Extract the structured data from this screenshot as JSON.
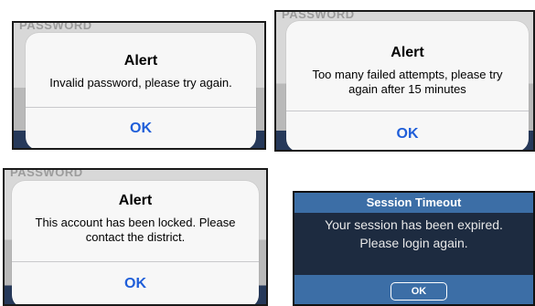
{
  "alerts": [
    {
      "ghost": "PASSWORD",
      "title": "Alert",
      "message": "Invalid password, please try again.",
      "button": "OK"
    },
    {
      "ghost": "PASSWORD",
      "title": "Alert",
      "message_lines": [
        "Too many failed attempts, please try",
        "again after 15 minutes"
      ],
      "button": "OK"
    },
    {
      "ghost": "PASSWORD",
      "title": "Alert",
      "message_lines": [
        "This account has been locked. Please",
        "contact the district."
      ],
      "button": "OK"
    }
  ],
  "session_timeout": {
    "title": "Session Timeout",
    "message_lines": [
      "Your session has been expired.",
      "Please login again."
    ],
    "button": "OK"
  },
  "colors": {
    "ok_blue": "#1f5ed9",
    "session_header": "#3c6ea6",
    "session_body": "#1d2b40"
  }
}
